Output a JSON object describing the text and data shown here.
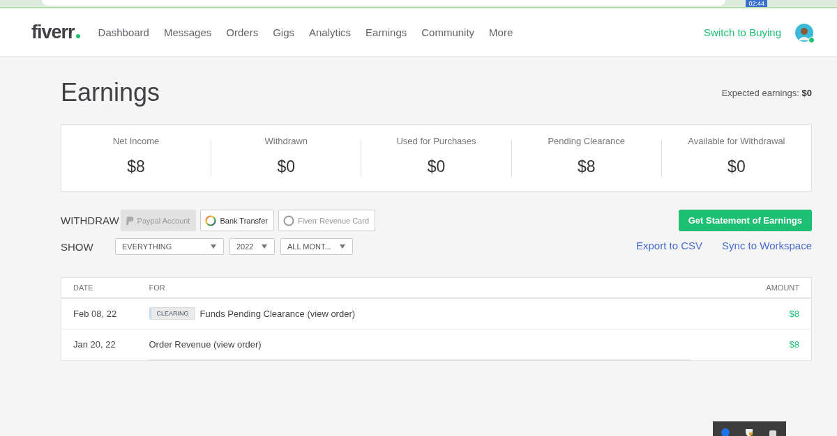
{
  "browser": {
    "clock": "02:44"
  },
  "nav": {
    "logo": "fiverr",
    "items": [
      "Dashboard",
      "Messages",
      "Orders",
      "Gigs",
      "Analytics",
      "Earnings",
      "Community",
      "More"
    ],
    "switch": "Switch to Buying",
    "avatar_online": true
  },
  "page": {
    "title": "Earnings",
    "expected_label": "Expected earnings:",
    "expected_value": "$0"
  },
  "stats": [
    {
      "label": "Net Income",
      "value": "$8"
    },
    {
      "label": "Withdrawn",
      "value": "$0"
    },
    {
      "label": "Used for Purchases",
      "value": "$0"
    },
    {
      "label": "Pending Clearance",
      "value": "$8"
    },
    {
      "label": "Available for Withdrawal",
      "value": "$0"
    }
  ],
  "withdraw": {
    "label": "WITHDRAW",
    "methods": [
      {
        "kind": "paypal",
        "label": "Paypal Account",
        "disabled": true
      },
      {
        "kind": "bank",
        "label": "Bank Transfer",
        "disabled": false
      },
      {
        "kind": "card",
        "label": "Fiverr Revenue Card",
        "disabled": true
      }
    ]
  },
  "statement_button": "Get Statement of Earnings",
  "show": {
    "label": "SHOW",
    "filters": [
      "EVERYTHING",
      "2022",
      "ALL MONT..."
    ]
  },
  "links": [
    "Export to CSV",
    "Sync to Workspace"
  ],
  "table": {
    "columns": [
      "DATE",
      "FOR",
      "AMOUNT"
    ],
    "rows": [
      {
        "date": "Feb 08, 22",
        "tag": "CLEARING",
        "for": "Funds Pending Clearance (view order)",
        "amount": "$8"
      },
      {
        "date": "Jan 20, 22",
        "for": "Order Revenue (view order)",
        "amount": "$8"
      }
    ]
  }
}
